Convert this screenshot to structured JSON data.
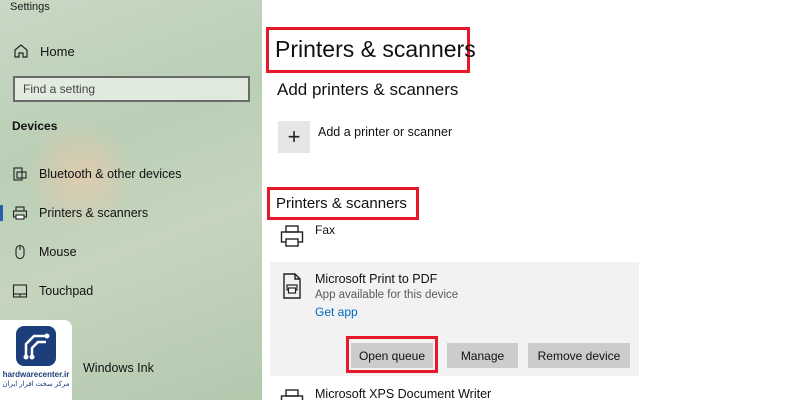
{
  "window": {
    "app_title": "Settings"
  },
  "sidebar": {
    "home_label": "Home",
    "search_placeholder": "Find a setting",
    "group_title": "Devices",
    "items": [
      {
        "label": "Bluetooth & other devices",
        "icon": "bluetooth-devices-icon"
      },
      {
        "label": "Printers & scanners",
        "icon": "printer-icon",
        "selected": true
      },
      {
        "label": "Mouse",
        "icon": "mouse-icon"
      },
      {
        "label": "Touchpad",
        "icon": "touchpad-icon"
      },
      {
        "label": "Windows Ink",
        "icon": "pen-icon"
      }
    ]
  },
  "main": {
    "page_title": "Printers & scanners",
    "add_section_title": "Add printers & scanners",
    "add_button_label": "Add a printer or scanner",
    "list_section_title": "Printers & scanners",
    "printers": [
      {
        "name": "Fax"
      },
      {
        "name": "Microsoft Print to PDF",
        "status": "App available for this device",
        "link": "Get app",
        "buttons": {
          "open_queue": "Open queue",
          "manage": "Manage",
          "remove": "Remove device"
        }
      },
      {
        "name": "Microsoft XPS Document Writer"
      }
    ]
  },
  "watermark": {
    "brand": "hardwarecenter.ir",
    "subtitle": "مرکز سخت افزار ایران"
  },
  "colors": {
    "highlight": "#e5192a",
    "link": "#0067c0",
    "accent": "#2a5db0"
  }
}
